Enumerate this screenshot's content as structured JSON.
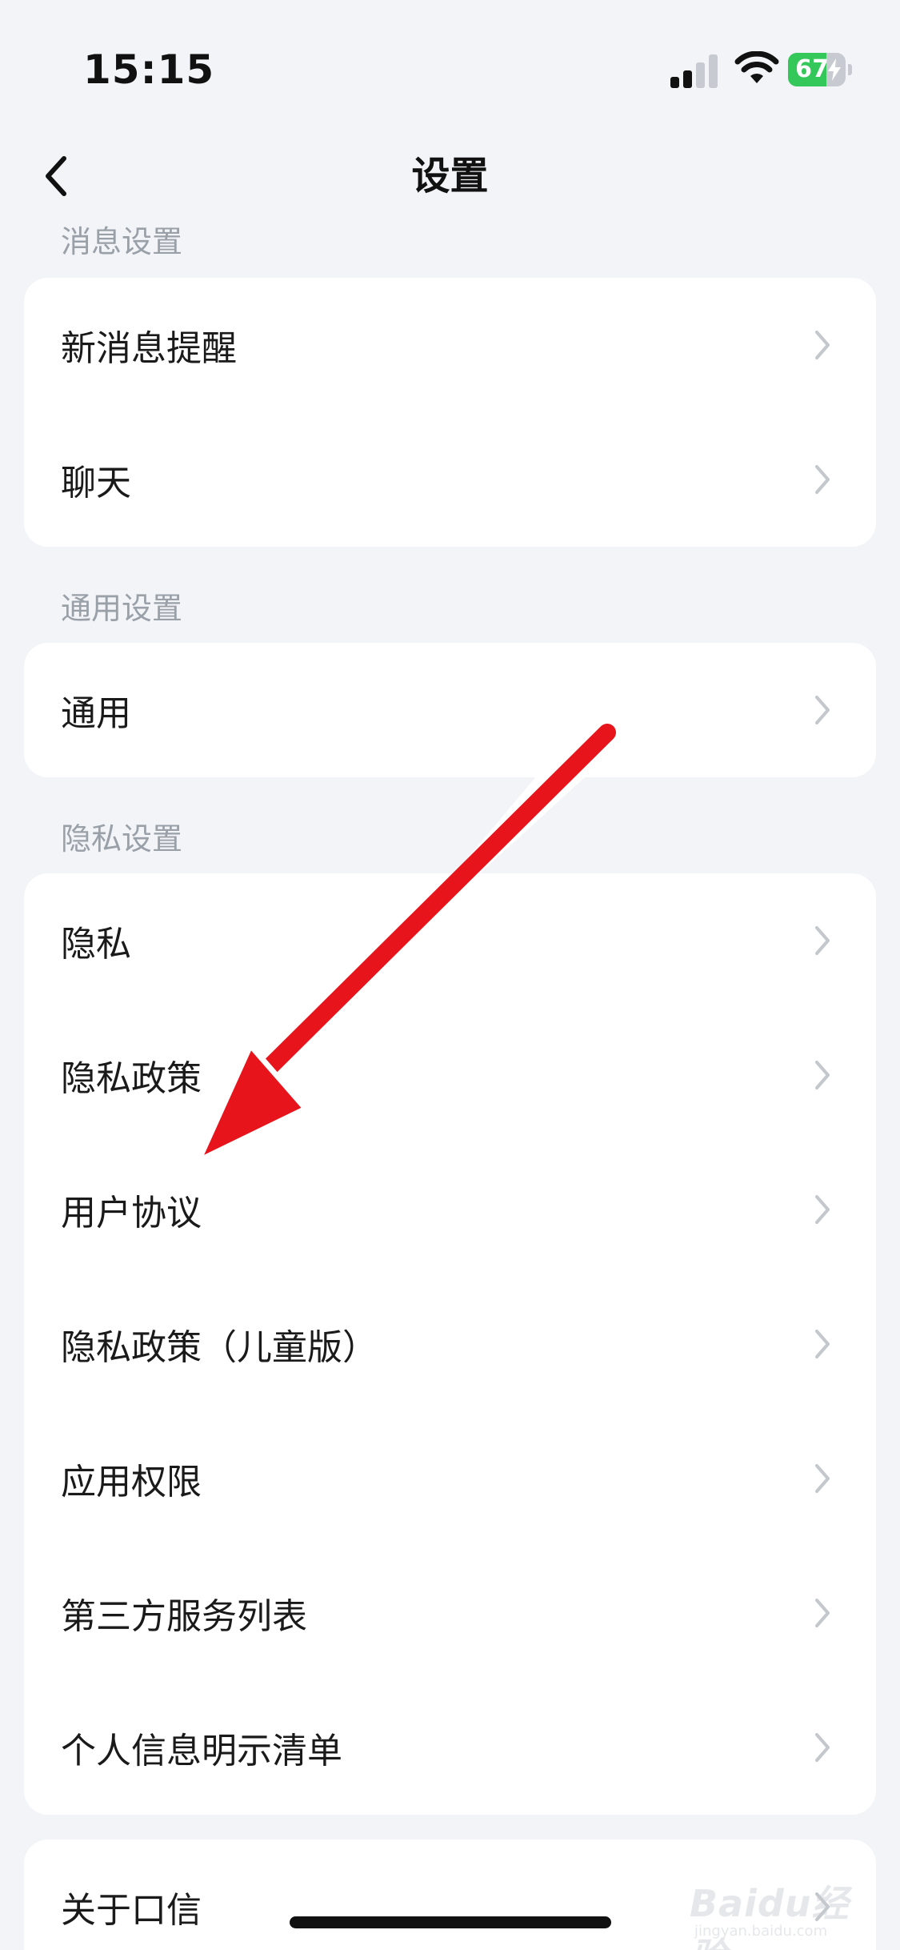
{
  "status_bar": {
    "time": "15:15",
    "battery_percent": 67,
    "battery_label": "67",
    "icons": [
      "signal-icon",
      "wifi-icon",
      "battery-icon",
      "charging-bolt-icon"
    ]
  },
  "nav": {
    "title": "设置",
    "back_icon": "chevron-left-icon"
  },
  "sections": {
    "message": {
      "header": "消息设置",
      "items": [
        {
          "label": "新消息提醒"
        },
        {
          "label": "聊天"
        }
      ]
    },
    "general": {
      "header": "通用设置",
      "items": [
        {
          "label": "通用"
        }
      ]
    },
    "privacy": {
      "header": "隐私设置",
      "items": [
        {
          "label": "隐私"
        },
        {
          "label": "隐私政策"
        },
        {
          "label": "用户协议"
        },
        {
          "label": "隐私政策（儿童版）"
        },
        {
          "label": "应用权限"
        },
        {
          "label": "第三方服务列表"
        },
        {
          "label": "个人信息明示清单"
        }
      ]
    },
    "about": {
      "items": [
        {
          "label": "关于口信"
        }
      ]
    }
  },
  "colors": {
    "background": "#f2f4f8",
    "card": "#ffffff",
    "section_header": "#9aa0a8",
    "battery_green": "#34c759",
    "annotation_red": "#e8141c"
  },
  "watermark": {
    "text": "Baidu经验",
    "sub": "jingyan.baidu.com"
  }
}
